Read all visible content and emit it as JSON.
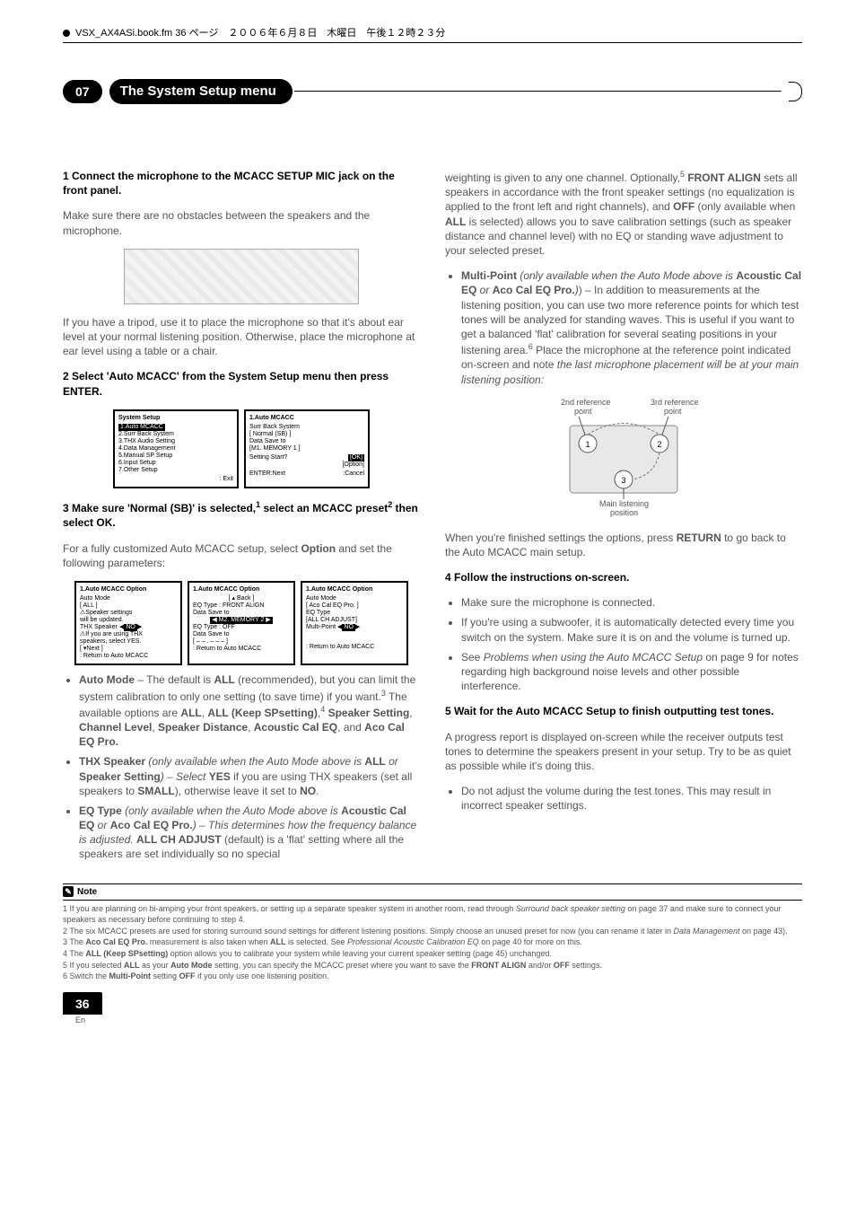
{
  "topbar": {
    "text": "VSX_AX4ASi.book.fm 36 ページ　２００６年６月８日　木曜日　午後１２時２３分"
  },
  "chapter": {
    "num": "07",
    "title": "The System Setup menu"
  },
  "left": {
    "s1_head": "1   Connect the microphone to the MCACC SETUP MIC jack on the front panel.",
    "s1_body": "Make sure there are no obstacles between the speakers and the microphone.",
    "tripod": "If you have a tripod, use it to place the microphone so that it's about ear level at your normal listening position. Otherwise, place the microphone at ear level using a table or a chair.",
    "s2_head": "2   Select 'Auto MCACC' from the System Setup menu then press ENTER.",
    "s3_head_a": "3   Make sure 'Normal (SB)' is selected,",
    "s3_sup1": "1",
    "s3_head_b": " select an MCACC preset",
    "s3_sup2": "2",
    "s3_head_c": " then select OK.",
    "s3_body_a": "For a fully customized Auto MCACC setup, select ",
    "s3_body_b": "Option",
    "s3_body_c": " and set the following parameters:",
    "b_automode_a": "Auto Mode",
    "b_automode_b": " – The default is ",
    "b_automode_c": "ALL",
    "b_automode_d": " (recommended), but you can limit the system calibration to only one setting (to save time) if you want.",
    "b_automode_sup3": "3",
    "b_automode_e": " The available options are ",
    "opts_all": "ALL",
    "opts_keep": "ALL (Keep SPsetting)",
    "sup4": "4",
    "opts_speaker": "Speaker Setting",
    "opts_chlevel": "Channel Level",
    "opts_spdist": "Speaker Distance",
    "opts_acal": "Acoustic Cal EQ",
    "opts_and": ", and ",
    "opts_aco": "Aco Cal EQ Pro.",
    "b_thx_a": "THX Speaker",
    "b_thx_b": " (only available when the Auto Mode above is ",
    "b_thx_c": "ALL",
    "b_thx_d": " or ",
    "b_thx_e": "Speaker Setting",
    "b_thx_f": ") – Select ",
    "b_thx_g": "YES",
    "b_thx_h": " if you are using THX speakers (set all speakers to ",
    "b_thx_i": "SMALL",
    "b_thx_j": "), otherwise leave it set to ",
    "b_thx_k": "NO",
    "b_thx_l": ".",
    "b_eq_a": "EQ Type",
    "b_eq_b": " (only available when the Auto Mode above is ",
    "b_eq_c": "Acoustic Cal EQ",
    "b_eq_d": " or ",
    "b_eq_e": "Aco Cal EQ Pro.",
    "b_eq_f": ") – This determines how the frequency balance is adjusted. ",
    "b_eq_g": "ALL CH ADJUST",
    "b_eq_h": " (default) is a 'flat' setting where all the speakers are set individually so no special"
  },
  "right": {
    "p1_a": "weighting is given to any one channel. Optionally,",
    "p1_sup5": "5",
    "p1_b": " ",
    "p1_c": "FRONT ALIGN",
    "p1_d": " sets all speakers in accordance with the front speaker settings (no equalization is applied to the front left and right channels), and ",
    "p1_e": "OFF",
    "p1_f": " (only available when ",
    "p1_g": "ALL",
    "p1_h": " is selected) allows you to save calibration settings (such as speaker distance and channel level) with no EQ or standing wave adjustment to your selected preset.",
    "mp_a": "Multi-Point",
    "mp_b": " (only available when the Auto Mode above is ",
    "mp_c": "Acoustic Cal EQ",
    "mp_d": " or ",
    "mp_e": "Aco Cal EQ Pro.",
    "mp_f": ") – In addition to measurements at the listening position, you can use two more reference points for which test tones will be analyzed for standing waves. This is useful if you want to get a balanced 'flat' calibration for several seating positions in your listening area.",
    "mp_sup6": "6",
    "mp_g": " Place the microphone at the reference point indicated on-screen and note ",
    "mp_h": "the last microphone placement will be at your main listening position:",
    "diag_2nd": "2nd reference point",
    "diag_3rd": "3rd reference point",
    "diag_main": "Main listening position",
    "after_a": "When you're finished settings the options, press ",
    "after_b": "RETURN",
    "after_c": " to go back to the Auto MCACC main setup.",
    "s4_head": "4   Follow the instructions on-screen.",
    "s4_li1": "Make sure the microphone is connected.",
    "s4_li2": "If you're using a subwoofer, it is automatically detected every time you switch on the system. Make sure it is on and the volume is turned up.",
    "s4_li3_a": "See ",
    "s4_li3_b": "Problems when using the Auto MCACC Setup",
    "s4_li3_c": " on page 9 for notes regarding high background noise levels and other possible interference.",
    "s5_head": "5   Wait for the Auto MCACC Setup to finish outputting test tones.",
    "s5_body": "A progress report is displayed on-screen while the receiver outputs test tones to determine the speakers present in your setup. Try to be as quiet as possible while it's doing this.",
    "s5_li1": "Do not adjust the volume during the test tones. This may result in incorrect speaker settings."
  },
  "osd": {
    "sys_title": "System  Setup",
    "sys_l1": "1.Auto  MCACC",
    "sys_l2": "2.Surr  Back  System",
    "sys_l3": "3.THX  Audio  Setting",
    "sys_l4": "4.Data  Management",
    "sys_l5": "5.Manual  SP  Setup",
    "sys_l6": "6.Input  Setup",
    "sys_l7": "7.Other  Setup",
    "sys_exit": "  : Exit",
    "auto_title": "1.Auto  MCACC",
    "auto_l1": "Surr  Back  System",
    "auto_l2": "[       Normal (SB)       ]",
    "auto_l3": "Data  Save  to",
    "auto_l4": "[M1.  MEMORY  1    ]",
    "auto_l5": "Setting  Start?",
    "auto_ok": "[OK]",
    "auto_opt": "[Option]",
    "auto_enter": "ENTER:Next",
    "auto_cancel": ":Cancel",
    "opt_title": "1.Auto  MCACC  Option",
    "o1_l1": "Auto  Mode",
    "o1_l2": "[          ALL          ]",
    "o1_l3": "⚠Speaker settings",
    "o1_l4": " will be updated.",
    "o1_l5": "THX  Speaker  ◀  NO  ▶",
    "o1_l6": "⚠If  you  are using  THX",
    "o1_l7": " speakers, select YES.",
    "o1_l8": "[ ▾Next ]",
    "o1_ret": " : Return  to  Auto  MCACC",
    "o2_l1": "[ ▴ Back ]",
    "o2_l2": "EQ  Type : FRONT  ALIGN",
    "o2_l3": "Data  Save  to",
    "o2_l4": "◀ M2. MEMORY 2 ▶",
    "o2_l5": "EQ  Type : OFF",
    "o2_l6": "Data  Save  to",
    "o2_l7": "[ – – . – – – ]",
    "o3_l1": "Auto  Mode",
    "o3_l2": "[  Aco  Cal  EQ  Pro.  ]",
    "o3_l3": "EQ  Type",
    "o3_l4": "[ALL  CH  ADJUST]",
    "o3_l5": "Multi-Point   ◀  NO  ▶"
  },
  "note_label": "Note",
  "footnotes": {
    "f1_a": "1 If you are planning on bi-amping your front speakers, or setting up a separate speaker system in another room, read through ",
    "f1_b": "Surround back speaker setting",
    "f1_c": " on page 37 and make sure to connect your speakers as necessary before continuing to step 4.",
    "f2_a": "2 The six MCACC presets are used for storing surround sound settings for different listening positions. Simply choose an unused preset for now (you can rename it later in ",
    "f2_b": "Data Management",
    "f2_c": " on page 43).",
    "f3_a": "3 The ",
    "f3_b": "Aco Cal EQ Pro.",
    "f3_c": " measurement is also taken when ",
    "f3_d": "ALL",
    "f3_e": " is selected. See ",
    "f3_f": "Professional Acoustic Calibration EQ",
    "f3_g": " on page 40 for more on this.",
    "f4_a": "4 The ",
    "f4_b": "ALL (Keep SPsetting)",
    "f4_c": " option allows you to calibrate your system while leaving your current speaker setting (page 45) unchanged.",
    "f5_a": "5 If you selected ",
    "f5_b": "ALL",
    "f5_c": " as your ",
    "f5_d": "Auto Mode",
    "f5_e": " setting, you can specify the MCACC preset where you want to save the ",
    "f5_f": "FRONT ALIGN",
    "f5_g": " and/or ",
    "f5_h": "OFF",
    "f5_i": " settings.",
    "f6_a": "6 Switch the ",
    "f6_b": "Multi-Point",
    "f6_c": " setting ",
    "f6_d": "OFF",
    "f6_e": " if you only use one listening position."
  },
  "page_num": "36",
  "page_lang": "En"
}
